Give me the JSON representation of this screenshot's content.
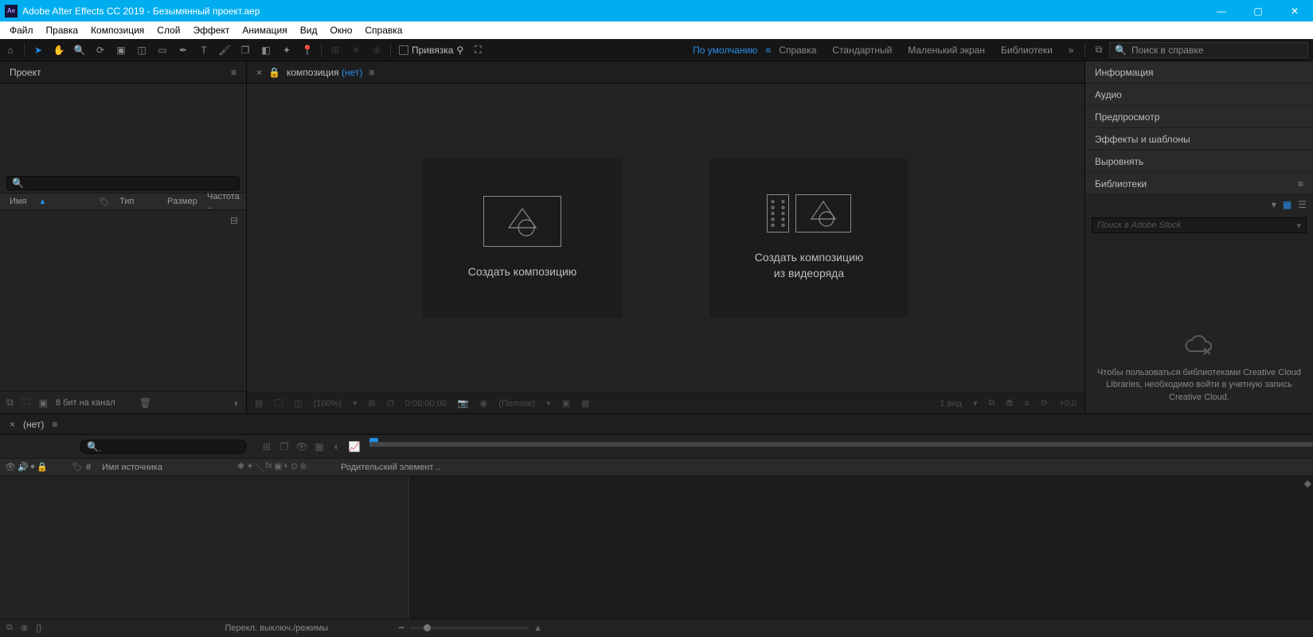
{
  "titlebar": {
    "app": "Adobe After Effects CC 2019",
    "doc": "Безымянный проект.aep"
  },
  "menu": [
    "Файл",
    "Правка",
    "Композиция",
    "Слой",
    "Эффект",
    "Анимация",
    "Вид",
    "Окно",
    "Справка"
  ],
  "toolbar": {
    "snapping": "Привязка",
    "workspaces": [
      "По умолчанию",
      "Справка",
      "Стандартный",
      "Маленький экран",
      "Библиотеки"
    ],
    "active_ws": 0,
    "search_placeholder": "Поиск в справке"
  },
  "project": {
    "tab": "Проект",
    "columns": {
      "name": "Имя",
      "type": "Тип",
      "size": "Размер",
      "rate": "Частота .."
    },
    "bpc": "8 бит на канал"
  },
  "composition": {
    "label_prefix": "композиция",
    "label_none": "(нет)",
    "create": "Создать композицию",
    "create_from_footage_l1": "Создать композицию",
    "create_from_footage_l2": "из видеоряда",
    "footer": {
      "zoom": "(100%)",
      "time": "0:00:00:00",
      "res": "(Полное)",
      "views": "1 вид",
      "exposure": "+0,0"
    }
  },
  "right": {
    "panels": [
      "Информация",
      "Аудио",
      "Предпросмотр",
      "Эффекты и шаблоны",
      "Выровнять",
      "Библиотеки"
    ],
    "stock_placeholder": "Поиск в Adobe Stock",
    "msg": "Чтобы пользоваться библиотеками Creative Cloud Libraries, необходимо войти в учетную запись Creative Cloud."
  },
  "timeline": {
    "tab": "(нет)",
    "col_num": "#",
    "col_src": "Имя источника",
    "col_parent": "Родительский элемент ..",
    "modes": "Перекл. выключ./режимы"
  }
}
